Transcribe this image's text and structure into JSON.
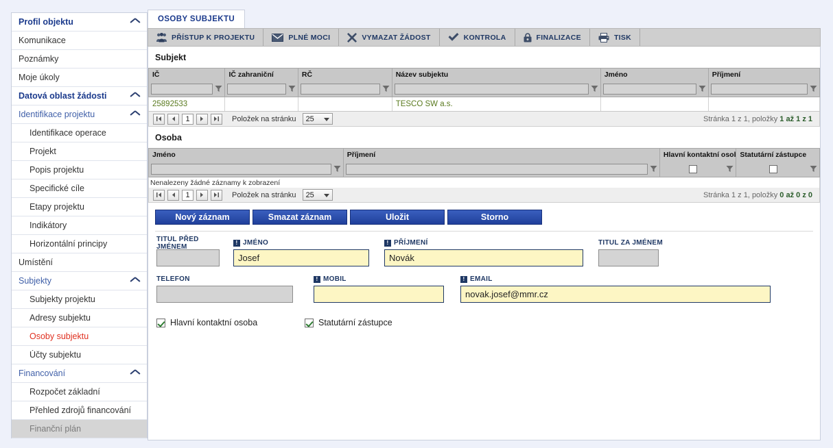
{
  "sidebar": {
    "items": [
      {
        "label": "Profil objektu",
        "type": "group-bold",
        "chevron": true,
        "state": "normal"
      },
      {
        "label": "Komunikace",
        "type": "leaf",
        "chevron": false,
        "state": "normal"
      },
      {
        "label": "Poznámky",
        "type": "leaf",
        "chevron": false,
        "state": "normal"
      },
      {
        "label": "Moje úkoly",
        "type": "leaf",
        "chevron": false,
        "state": "normal"
      },
      {
        "label": "Datová oblast žádosti",
        "type": "group-bold",
        "chevron": true,
        "state": "normal"
      },
      {
        "label": "Identifikace projektu",
        "type": "group",
        "chevron": true,
        "state": "normal"
      },
      {
        "label": "Identifikace operace",
        "type": "child",
        "chevron": false,
        "state": "normal"
      },
      {
        "label": "Projekt",
        "type": "child",
        "chevron": false,
        "state": "normal"
      },
      {
        "label": "Popis projektu",
        "type": "child",
        "chevron": false,
        "state": "normal"
      },
      {
        "label": "Specifické cíle",
        "type": "child",
        "chevron": false,
        "state": "normal"
      },
      {
        "label": "Etapy projektu",
        "type": "child",
        "chevron": false,
        "state": "normal"
      },
      {
        "label": "Indikátory",
        "type": "child",
        "chevron": false,
        "state": "normal"
      },
      {
        "label": "Horizontální principy",
        "type": "child",
        "chevron": false,
        "state": "normal"
      },
      {
        "label": "Umístění",
        "type": "leaf",
        "chevron": false,
        "state": "normal"
      },
      {
        "label": "Subjekty",
        "type": "group",
        "chevron": true,
        "state": "normal"
      },
      {
        "label": "Subjekty projektu",
        "type": "child",
        "chevron": false,
        "state": "normal"
      },
      {
        "label": "Adresy subjektu",
        "type": "child",
        "chevron": false,
        "state": "normal"
      },
      {
        "label": "Osoby subjektu",
        "type": "child",
        "chevron": false,
        "state": "active"
      },
      {
        "label": "Účty subjektu",
        "type": "child",
        "chevron": false,
        "state": "normal"
      },
      {
        "label": "Financování",
        "type": "group",
        "chevron": true,
        "state": "normal"
      },
      {
        "label": "Rozpočet základní",
        "type": "child",
        "chevron": false,
        "state": "normal"
      },
      {
        "label": "Přehled zdrojů financování",
        "type": "child",
        "chevron": false,
        "state": "normal"
      },
      {
        "label": "Finanční plán",
        "type": "child",
        "chevron": false,
        "state": "disabled"
      }
    ]
  },
  "tab": {
    "label": "OSOBY SUBJEKTU"
  },
  "toolbar": {
    "buttons": [
      {
        "label": "PŘÍSTUP K PROJEKTU",
        "icon": "people-icon"
      },
      {
        "label": "PLNÉ MOCI",
        "icon": "envelope-icon"
      },
      {
        "label": "VYMAZAT ŽÁDOST",
        "icon": "x-cross-icon"
      },
      {
        "label": "KONTROLA",
        "icon": "checkmark-icon"
      },
      {
        "label": "FINALIZACE",
        "icon": "lock-icon"
      },
      {
        "label": "TISK",
        "icon": "printer-icon"
      }
    ]
  },
  "subjekt": {
    "title": "Subjekt",
    "columns": [
      "IČ",
      "IČ zahraniční",
      "RČ",
      "Název subjektu",
      "Jméno",
      "Příjmení"
    ],
    "filters": [
      "",
      "",
      "",
      "",
      "",
      ""
    ],
    "rows": [
      {
        "cells": [
          "25892533",
          "",
          "",
          "TESCO SW a.s.",
          "",
          ""
        ]
      }
    ],
    "pager": {
      "page": "1",
      "per_page_label": "Položek na stránku",
      "per_page_value": "25",
      "info_prefix": "Stránka 1 z 1, položky ",
      "info_bold": "1 až 1 z 1"
    }
  },
  "osoba": {
    "title": "Osoba",
    "columns": [
      "Jméno",
      "Příjmení",
      "Hlavní kontaktní osoba",
      "Statutární zástupce"
    ],
    "empty_message": "Nenalezeny žádné záznamy k zobrazení",
    "pager": {
      "page": "1",
      "per_page_label": "Položek na stránku",
      "per_page_value": "25",
      "info_prefix": "Stránka 1 z 1, položky ",
      "info_bold": "0 až 0 z 0"
    }
  },
  "actions": {
    "new_label": "Nový záznam",
    "delete_label": "Smazat záznam",
    "save_label": "Uložit",
    "cancel_label": "Storno"
  },
  "form": {
    "titul_pred": {
      "label": "TITUL PŘED JMÉNEM",
      "value": "",
      "required": false
    },
    "jmeno": {
      "label": "JMÉNO",
      "value": "Josef",
      "required": true
    },
    "prijmeni": {
      "label": "PŘÍJMENÍ",
      "value": "Novák",
      "required": true
    },
    "titul_za": {
      "label": "TITUL ZA JMÉNEM",
      "value": "",
      "required": false
    },
    "telefon": {
      "label": "TELEFON",
      "value": "",
      "required": false
    },
    "mobil": {
      "label": "MOBIL",
      "value": "",
      "required": true
    },
    "email": {
      "label": "EMAIL",
      "value": "novak.josef@mmr.cz",
      "required": true
    },
    "checkbox_hlavni": {
      "label": "Hlavní kontaktní osoba",
      "checked": true
    },
    "checkbox_statutarni": {
      "label": "Statutární zástupce",
      "checked": true
    }
  },
  "colors": {
    "accent_blue": "#1f3864",
    "button_blue": "#20409b",
    "active_red": "#e03020",
    "data_green": "#5a7a1f",
    "required_yellow": "#fdf6c4"
  }
}
